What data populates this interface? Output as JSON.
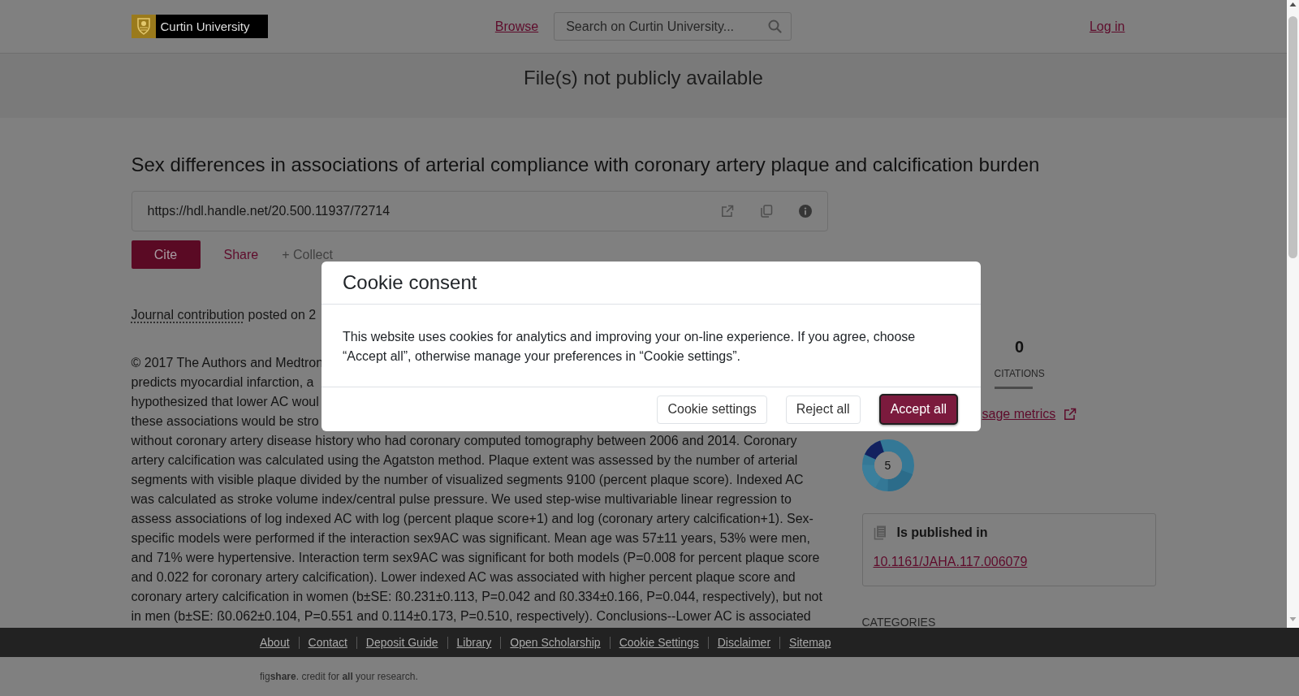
{
  "header": {
    "logo_text": "Curtin University",
    "nav": [
      {
        "label": "Browse"
      }
    ],
    "search": {
      "placeholder": "Search on Curtin University..."
    },
    "login": "Log in"
  },
  "banner": {
    "text": "File(s) not publicly available"
  },
  "item": {
    "title": "Sex differences in associations of arterial compliance with coronary artery plaque and calcification burden",
    "handle_url": "https://hdl.handle.net/20.500.11937/72714",
    "actions": [
      {
        "kind": "primary",
        "label": "Cite"
      },
      {
        "kind": "link",
        "label": "Share"
      },
      {
        "kind": "plain",
        "label": "+ Collect"
      }
    ],
    "type_link": "Journal contribution",
    "posted_text": "posted on 2",
    "abstract": {
      "partly_hidden_lines": [
        "© 2017 The Authors and Medtron",
        "predicts myocardial infarction, a",
        "hypothesized that lower AC woul",
        "these associations would be stro"
      ],
      "text": "without coronary artery disease history who had coronary computed tomography between 2006 and 2014. Coronary artery calcification was calculated using the Agatston method. Plaque extent was assessed by the number of arterial segments with visible plaque divided by the number of visualized segments 9100 (percent plaque score). Indexed AC was calculated as stroke volume index/central pulse pressure. We used step-wise multivariable linear regression to assess associations of log indexed AC with log (percent plaque score+1) and log (coronary artery calcification+1). Sex-specific models were performed if the interaction sex9AC was significant. Mean age was 57±11 years, 53% were men, and 71% were hypertensive. Interaction term sex9AC was significant for both models (P=0.008 for percent plaque score and 0.022 for coronary artery calcification). Lower indexed AC was associated with higher percent plaque score and coronary artery calcification in women (b±SE: ß0.231±0.113, P=0.042 and ß0.334±0.166, P=0.044, respectively), but not in men (b±SE: ß0.062±0.104, P=0.551 and 0.114±0.173, P=0.510, respectively). Conclusions--Lower AC is associated"
    }
  },
  "sidebar": {
    "metrics": [
      {
        "value": "0",
        "label": "CITATIONS"
      }
    ],
    "usage_link": "sage metrics",
    "attention_score": "5",
    "published_in": {
      "heading": "Is published in",
      "doi": "10.1161/JAHA.117.006079"
    },
    "categories_heading": "CATEGORIES"
  },
  "cookie_dialog": {
    "title": "Cookie consent",
    "message": "This website uses cookies for analytics and improving your on-line experience. If you agree, choose “Accept all”, otherwise manage your preferences in “Cookie settings”.",
    "buttons": [
      {
        "kind": "secondary",
        "label": "Cookie settings",
        "focused": false
      },
      {
        "kind": "secondary",
        "label": "Reject all",
        "focused": false
      },
      {
        "kind": "primary",
        "label": "Accept all",
        "focused": true
      }
    ]
  },
  "footer": {
    "links": [
      "About",
      "Contact",
      "Deposit Guide",
      "Library",
      "Open Scholarship",
      "Cookie Settings",
      "Disclaimer",
      "Sitemap"
    ],
    "tagline": "fig**share**. credit for **all** your research."
  }
}
